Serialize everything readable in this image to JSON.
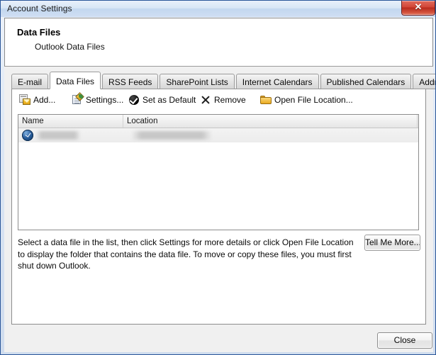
{
  "window": {
    "title": "Account Settings",
    "close_glyph": "✕"
  },
  "header": {
    "title": "Data Files",
    "subtitle": "Outlook Data Files"
  },
  "tabs": [
    {
      "label": "E-mail",
      "selected": false
    },
    {
      "label": "Data Files",
      "selected": true
    },
    {
      "label": "RSS Feeds",
      "selected": false
    },
    {
      "label": "SharePoint Lists",
      "selected": false
    },
    {
      "label": "Internet Calendars",
      "selected": false
    },
    {
      "label": "Published Calendars",
      "selected": false
    },
    {
      "label": "Address Books",
      "selected": false
    }
  ],
  "toolbar": {
    "add": "Add...",
    "settings": "Settings...",
    "set_default": "Set as Default",
    "remove": "Remove",
    "open_file_location": "Open File Location..."
  },
  "list": {
    "columns": [
      "Name",
      "Location"
    ],
    "rows": [
      {
        "name": "",
        "location": "",
        "redacted": true,
        "selected": true
      }
    ]
  },
  "description": "Select a data file in the list, then click Settings for more details or click Open File Location to display the folder that contains the data file. To move or copy these files, you must first shut down Outlook.",
  "buttons": {
    "tell_me_more": "Tell Me More...",
    "close": "Close"
  }
}
